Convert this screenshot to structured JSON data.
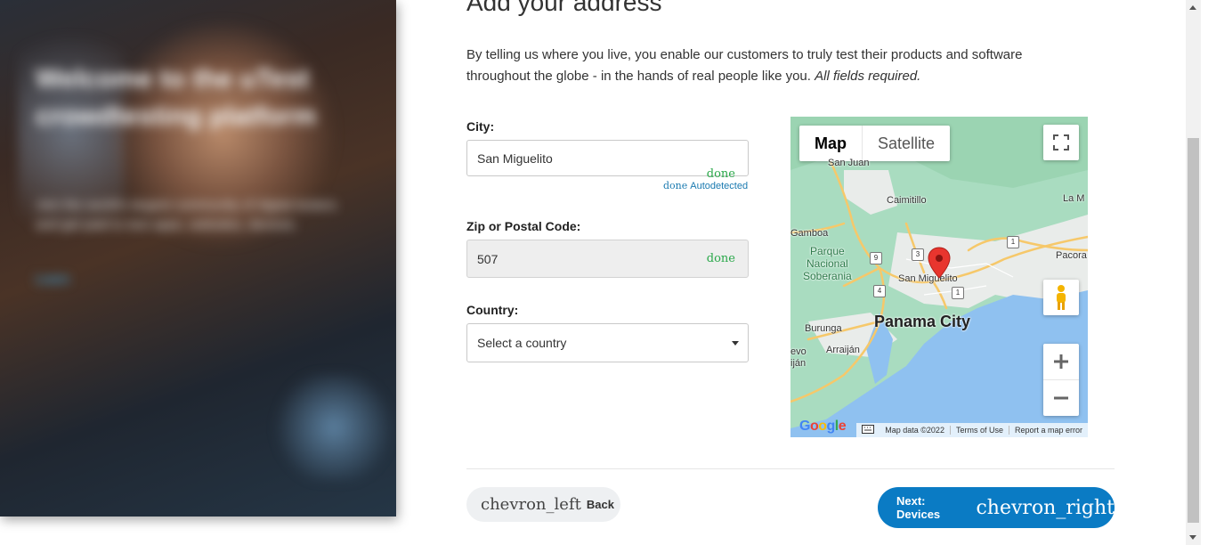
{
  "left_panel": {
    "headline": "Welcome to the uTest crowdtesting platform",
    "body": "Join the world's largest community of digital testers and get paid to test apps, websites, devices.",
    "link": "Learn"
  },
  "page": {
    "title": "Add your address",
    "intro": "By telling us where you live, you enable our customers to truly test their products and software throughout the globe - in the hands of real people like you.",
    "intro_italic": "All fields required."
  },
  "city": {
    "label": "City:",
    "value": "San Miguelito",
    "done": "done",
    "auto_icon": "done",
    "auto_text": "Autodetected"
  },
  "zip": {
    "label": "Zip or Postal Code:",
    "value": "507",
    "done": "done"
  },
  "country": {
    "label": "Country:",
    "value": "Select a country"
  },
  "map": {
    "type_map": "Map",
    "type_satellite": "Satellite",
    "labels": {
      "san_juan": "San Juan",
      "caimitillo": "Caimitillo",
      "la_m": "La M",
      "gamboa": "Gamboa",
      "parque": "Parque\nNacional\nSoberania",
      "san_miguelito": "San Miguelito",
      "pacora": "Pacora",
      "panama_city": "Panama City",
      "burunga": "Burunga",
      "arraijan": "Arraiján",
      "evo": "evo\niján"
    },
    "shields": [
      "9",
      "3",
      "4",
      "1",
      "1"
    ],
    "google": "Google",
    "attribution": [
      "Map data ©2022",
      "Terms of Use",
      "Report a map error"
    ],
    "colors": {
      "water": "#8fc1f0",
      "park": "#a9dcc0",
      "urban": "#e8e8e8",
      "road": "#f6c86a",
      "pin": "#e8352e"
    }
  },
  "nav": {
    "back_icon": "chevron_left",
    "back_label": "Back",
    "next_label": "Next: Devices",
    "next_icon": "chevron_right"
  }
}
